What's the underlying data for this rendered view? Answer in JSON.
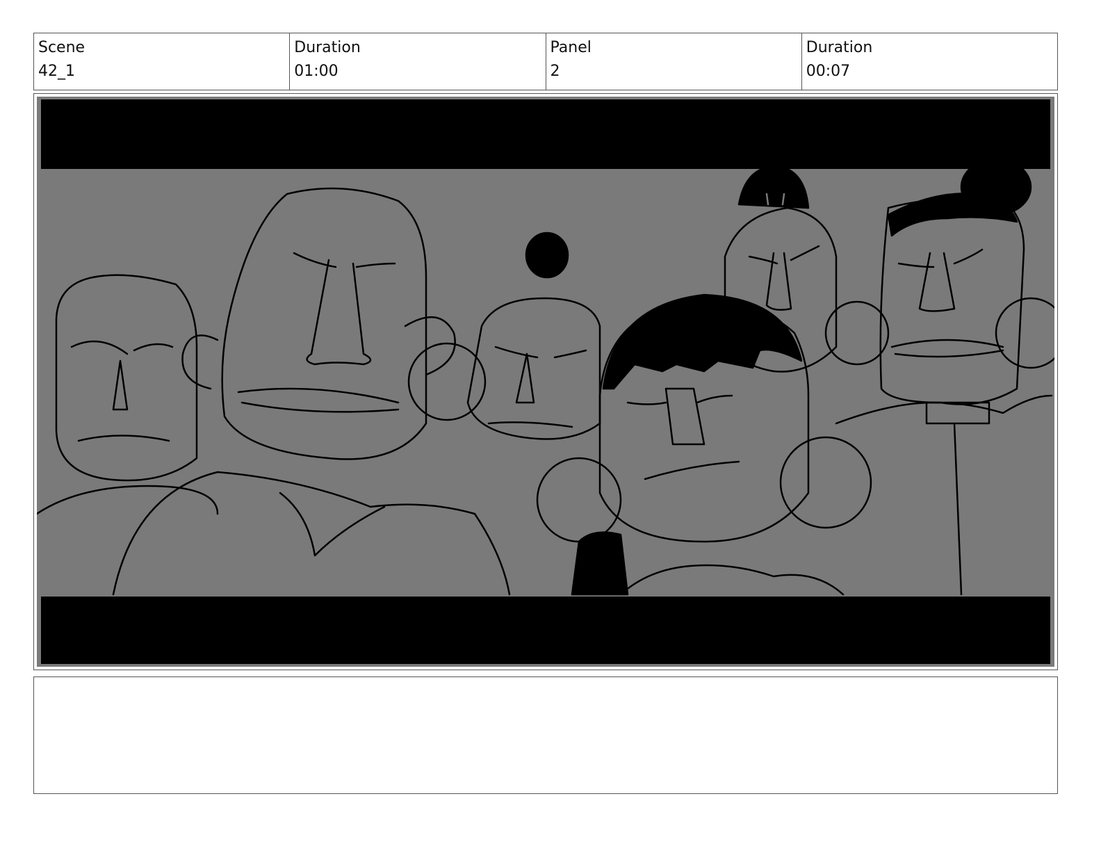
{
  "header": {
    "scene_label": "Scene",
    "scene_value": "42_1",
    "scene_duration_label": "Duration",
    "scene_duration_value": "01:00",
    "panel_label": "Panel",
    "panel_value": "2",
    "panel_duration_label": "Duration",
    "panel_duration_value": "00:07"
  },
  "panel_image": {
    "description_icon": "storyboard-sketch",
    "colors": {
      "letterbox": "#000000",
      "background": "#7a7a7a",
      "line": "#000000"
    }
  },
  "notes": {
    "text": ""
  }
}
